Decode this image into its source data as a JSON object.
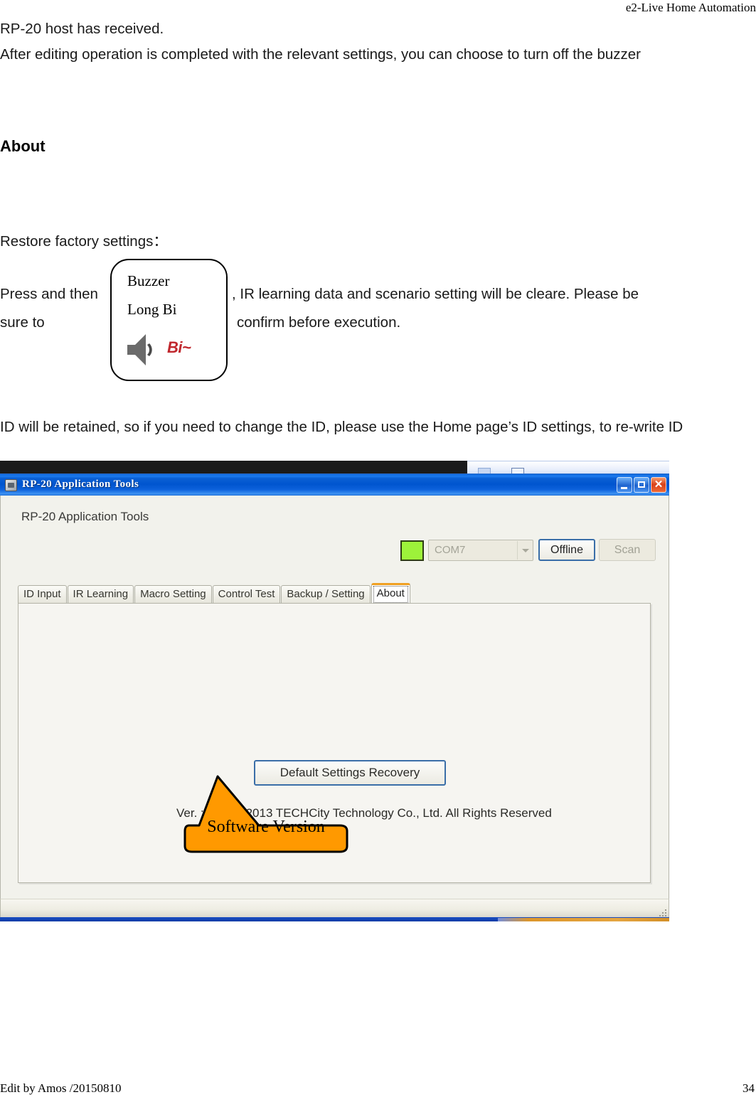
{
  "document": {
    "header_right": "e2-Live Home Automation",
    "paragraph_intro": "RP-20 host has received.\nAfter editing operation is completed with the relevant settings, you can choose to turn off the buzzer",
    "heading_about": "About",
    "paragraph_restore": "Restore factory settings：",
    "press_part1": "Press and then",
    "press_part2": ", IR learning data and scenario setting will be cleare. Please be",
    "press_part3": "sure to",
    "press_part4": "confirm before execution.",
    "paragraph_id_retained": "ID will be retained, so if you need to change the ID, please use the Home page’s ID settings, to re-write ID",
    "footer_left": "Edit by Amos /20150810",
    "footer_page": "34"
  },
  "buzzer_callout": {
    "line1": "Buzzer",
    "line2": "Long Bi",
    "sound_label": "Bi~",
    "speaker_icon": "speaker-icon",
    "speaker_color": "#6b6b6b",
    "sound_color": "#c0272d"
  },
  "app": {
    "titlebar": {
      "title": "RP-20 Application Tools",
      "icon": "app-icon",
      "minimize_label": "_",
      "maximize_label": "□",
      "close_label": "✕",
      "accent_color": "#0055cf"
    },
    "toolbar": {
      "heading": "RP-20 Application Tools",
      "status_indicator_color": "#9df23a",
      "com_port_value": "COM7",
      "com_port_placeholder": "COM7",
      "dropdown_icon": "chevron-down-icon",
      "connection_button": "Offline",
      "scan_button": "Scan"
    },
    "tabs": [
      {
        "label": "ID Input",
        "active": false
      },
      {
        "label": "IR Learning",
        "active": false
      },
      {
        "label": "Macro Setting",
        "active": false
      },
      {
        "label": "Control Test",
        "active": false
      },
      {
        "label": "Backup / Setting",
        "active": false
      },
      {
        "label": "About",
        "active": true
      }
    ],
    "about_panel": {
      "default_settings_button": "Default Settings Recovery",
      "version_text": "Ver. : v1.5 © 2013 TECHCity Technology Co., Ltd. All Rights Reserved",
      "underline_color": "#ee1c25"
    }
  },
  "annotation_callout": {
    "label": "Software Version",
    "fill_color": "#FF9900",
    "stroke_color": "#000000"
  }
}
